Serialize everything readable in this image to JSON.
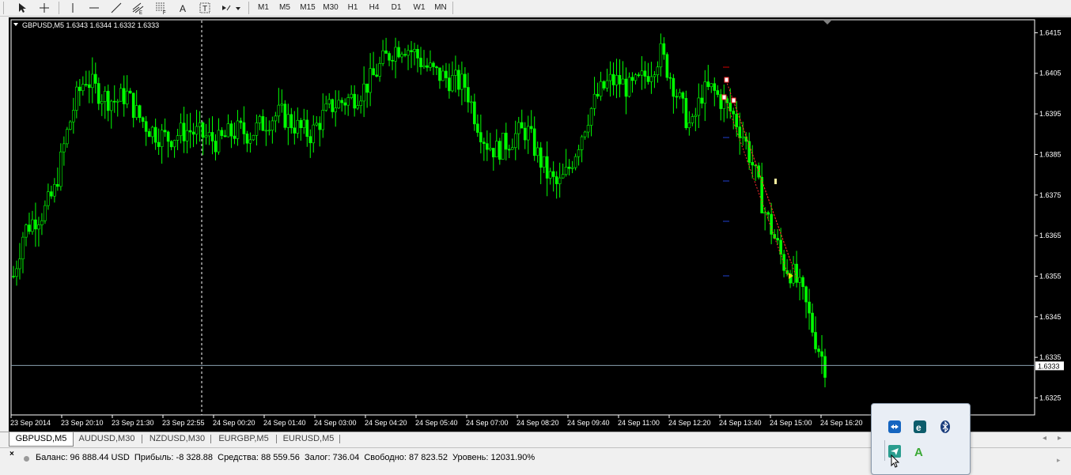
{
  "toolbar": {
    "tools": [
      "cursor-icon",
      "crosshair-icon",
      "vertical-line-icon",
      "horizontal-line-icon",
      "trendline-icon",
      "equidistant-channel-icon",
      "fibonacci-icon",
      "text-icon",
      "text-label-icon",
      "arrows-icon"
    ],
    "timeframes": [
      "M1",
      "M5",
      "M15",
      "M30",
      "H1",
      "H4",
      "D1",
      "W1",
      "MN"
    ]
  },
  "chart": {
    "header": "GBPUSD,M5  1.6343 1.6344 1.6332 1.6333",
    "current_price_label": "1.6333",
    "bid_line_price": 1.6333,
    "candle_color": "#00ff00",
    "background": "#000000",
    "y_ticks": [
      "1.6415",
      "1.6405",
      "1.6395",
      "1.6385",
      "1.6375",
      "1.6365",
      "1.6355",
      "1.6345",
      "1.6335",
      "1.6325"
    ],
    "x_ticks": [
      "23 Sep 2014",
      "23 Sep 20:10",
      "23 Sep 21:30",
      "23 Sep 22:55",
      "24 Sep 00:20",
      "24 Sep 01:40",
      "24 Sep 03:00",
      "24 Sep 04:20",
      "24 Sep 05:40",
      "24 Sep 07:00",
      "24 Sep 08:20",
      "24 Sep 09:40",
      "24 Sep 11:00",
      "24 Sep 12:20",
      "24 Sep 13:40",
      "24 Sep 15:00",
      "24 Sep 16:20"
    ]
  },
  "chart_data": {
    "type": "candlestick-line",
    "symbol": "GBPUSD",
    "timeframe": "M5",
    "ylim": [
      1.6321,
      1.6418
    ],
    "x": [
      "23 Sep 2014",
      "23 Sep 20:10",
      "23 Sep 21:30",
      "23 Sep 22:55",
      "24 Sep 00:20",
      "24 Sep 01:40",
      "24 Sep 03:00",
      "24 Sep 04:20",
      "24 Sep 05:40",
      "24 Sep 07:00",
      "24 Sep 08:20",
      "24 Sep 09:40",
      "24 Sep 11:00",
      "24 Sep 12:20",
      "24 Sep 13:40",
      "24 Sep 15:00",
      "24 Sep 16:20"
    ],
    "close_path": [
      1.6355,
      1.6366,
      1.6369,
      1.6371,
      1.6376,
      1.6388,
      1.6398,
      1.6404,
      1.6401,
      1.6399,
      1.6398,
      1.64,
      1.6395,
      1.6392,
      1.639,
      1.6389,
      1.639,
      1.6391,
      1.639,
      1.6389,
      1.6388,
      1.639,
      1.6391,
      1.639,
      1.6392,
      1.6394,
      1.6395,
      1.6393,
      1.6391,
      1.639,
      1.6394,
      1.6397,
      1.6398,
      1.6399,
      1.6401,
      1.6404,
      1.6408,
      1.6411,
      1.6412,
      1.641,
      1.6407,
      1.6405,
      1.6404,
      1.6403,
      1.6402,
      1.6394,
      1.6388,
      1.6386,
      1.6388,
      1.639,
      1.6391,
      1.6385,
      1.638,
      1.6377,
      1.6381,
      1.6388,
      1.6395,
      1.64,
      1.6403,
      1.6403,
      1.6401,
      1.6403,
      1.6406,
      1.641,
      1.6404,
      1.6397,
      1.6391,
      1.64,
      1.6401,
      1.6398,
      1.6395,
      1.639,
      1.6382,
      1.6372,
      1.6365,
      1.6358,
      1.6355,
      1.6349,
      1.634,
      1.6333
    ]
  },
  "tabs": [
    "GBPUSD,M5",
    "AUDUSD,M30",
    "NZDUSD,M30",
    "EURGBP,M5",
    "EURUSD,M5"
  ],
  "status": {
    "text": "Баланс: 96 888.44 USD  Прибыль: -8 328.88  Средства: 88 559.56  Залог: 736.04  Свободно: 87 823.52  Уровень: 12031.90%"
  },
  "tray": {
    "icons": [
      "teamviewer-icon",
      "e-app-icon",
      "bluetooth-icon",
      "telegram-icon",
      "green-a-icon"
    ]
  }
}
